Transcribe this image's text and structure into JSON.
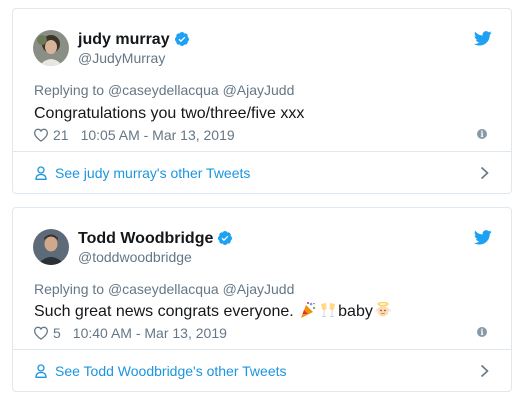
{
  "tweets": [
    {
      "name": "judy murray",
      "handle": "@JudyMurray",
      "replying_to_label": "Replying to",
      "mentions": [
        "@caseydellacqua",
        "@AjayJudd"
      ],
      "text": "Congratulations you two/three/five xxx",
      "likes": "21",
      "timestamp": "10:05 AM - Mar 13, 2019",
      "footer_link": "See judy murray's other Tweets"
    },
    {
      "name": "Todd Woodbridge",
      "handle": "@toddwoodbridge",
      "replying_to_label": "Replying to",
      "mentions": [
        "@caseydellacqua",
        "@AjayJudd"
      ],
      "text_before_emoji": "Such great news congrats everyone. ",
      "text_after_emoji": "baby",
      "emojis": [
        "party-popper-icon",
        "clinking-glasses-icon",
        "baby-angel-icon"
      ],
      "likes": "5",
      "timestamp": "10:40 AM - Mar 13, 2019",
      "footer_link": "See Todd Woodbridge's other Tweets"
    }
  ],
  "colors": {
    "link": "#1b95e0",
    "muted": "#657786",
    "verified": "#1da1f2",
    "border": "#e1e8ed"
  }
}
